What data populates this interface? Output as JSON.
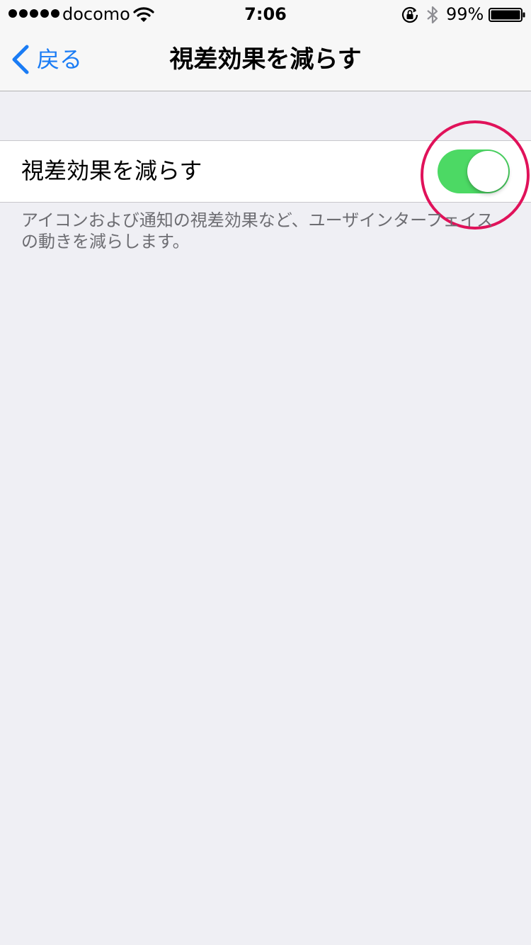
{
  "status_bar": {
    "carrier": "docomo",
    "time": "7:06",
    "battery_percent": "99%",
    "signal_bars": 5,
    "icons": [
      "wifi-icon",
      "rotation-lock-icon",
      "bluetooth-icon",
      "battery-icon"
    ]
  },
  "nav": {
    "back_label": "戻る",
    "title": "視差効果を減らす"
  },
  "setting": {
    "label": "視差効果を減らす",
    "toggle_on": true,
    "footer": "アイコンおよび通知の視差効果など、ユーザインターフェイスの動きを減らします。"
  },
  "colors": {
    "accent": "#1a7cf5",
    "toggle_on": "#4cd964",
    "highlight": "#e0125a",
    "background": "#efeff4"
  }
}
